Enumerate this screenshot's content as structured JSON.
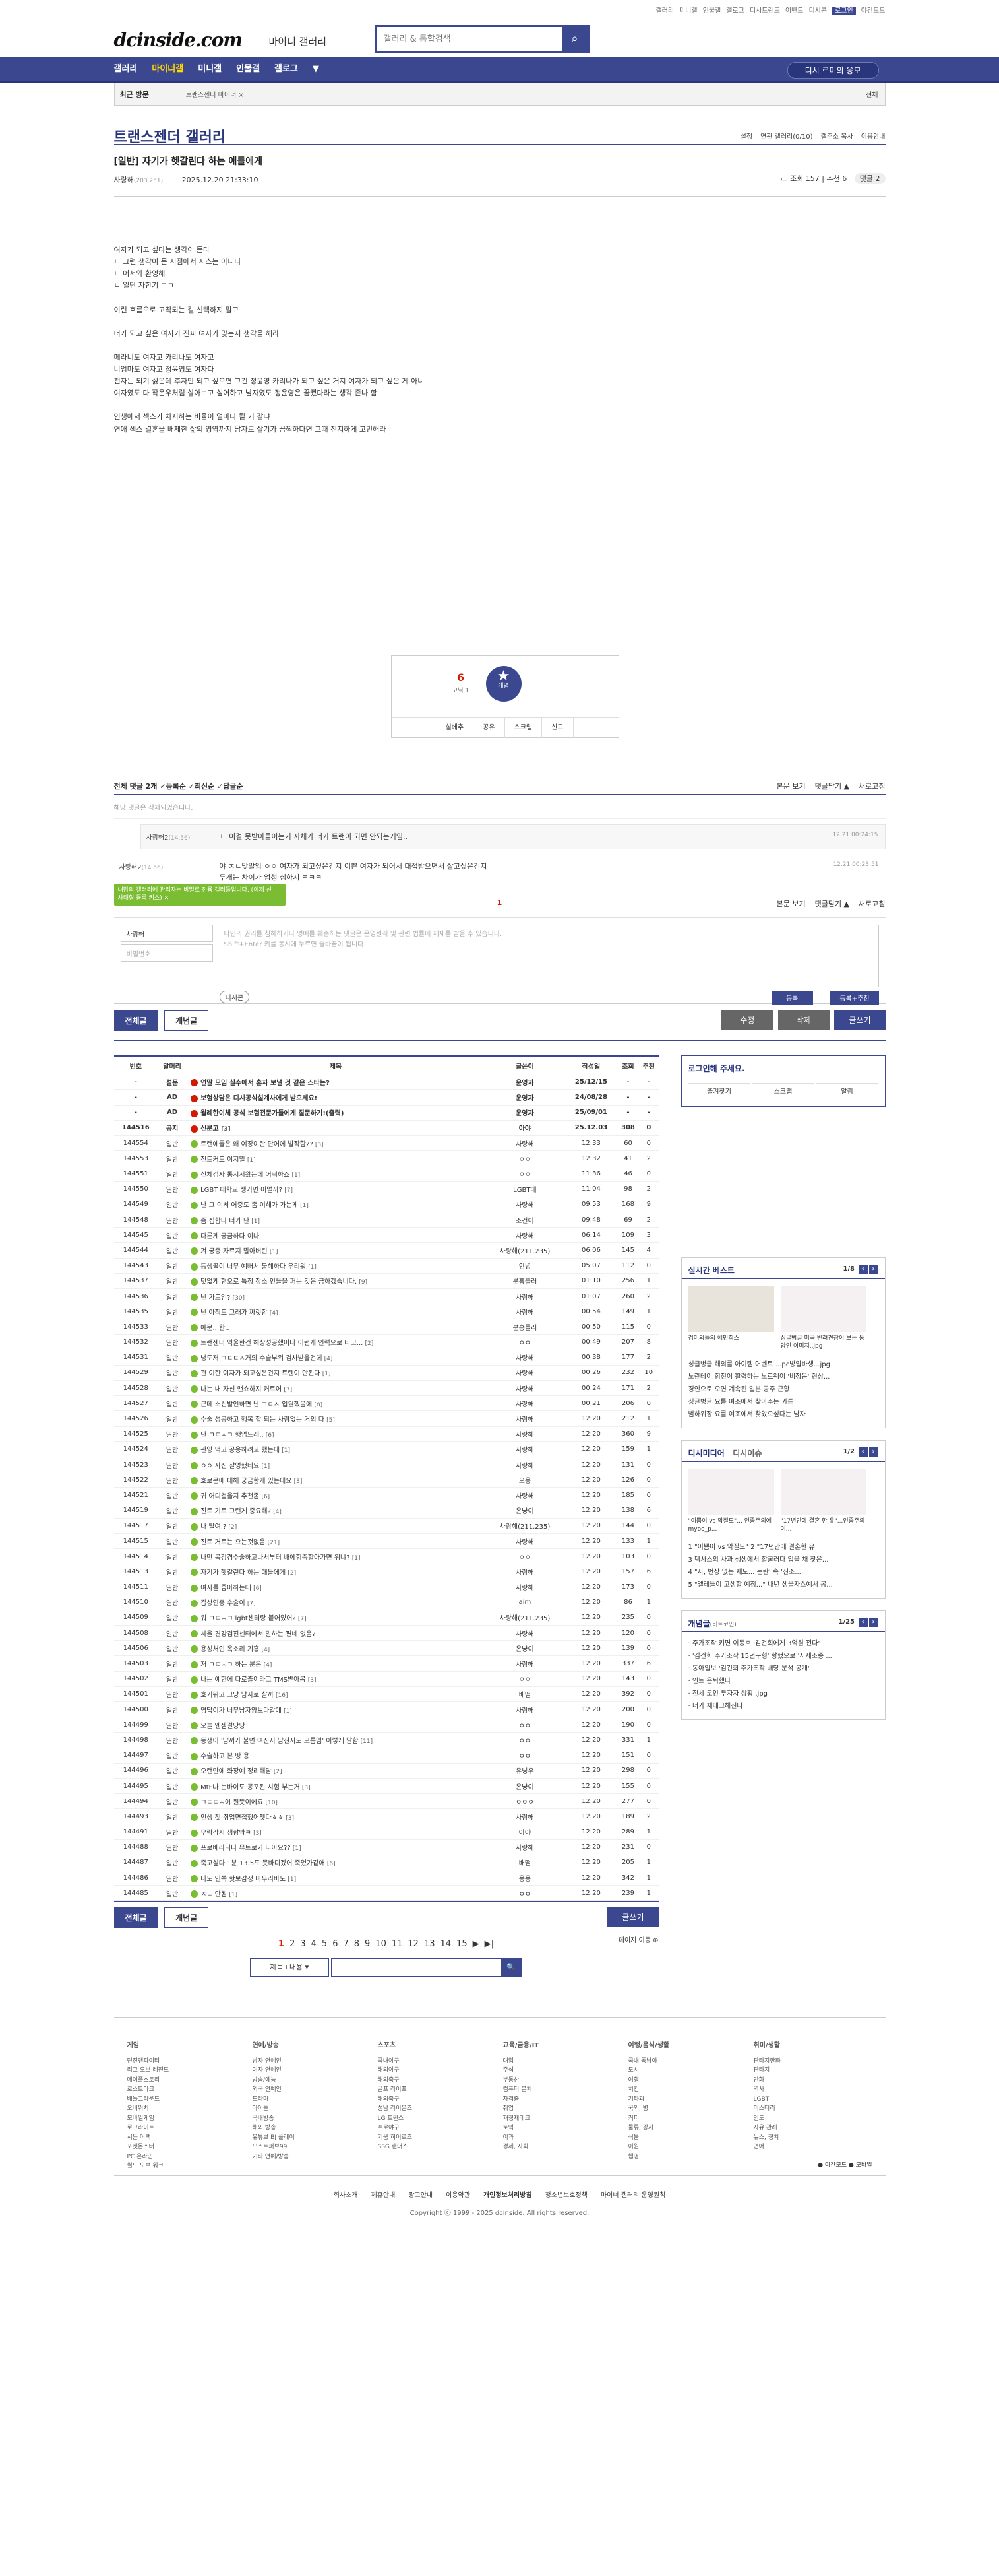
{
  "topnav": [
    "갤러리",
    "미니갤",
    "인물갤",
    "갤로그",
    "디시트렌드",
    "이벤트",
    "디시콘",
    "로그인",
    "야간모드"
  ],
  "logo": "dcinside.com",
  "logo_sub": "마이너 갤러리",
  "search": {
    "placeholder": "갤러리 & 통합검색"
  },
  "gnb": [
    "갤러리",
    "마이너갤",
    "미니갤",
    "인물갤",
    "갤로그"
  ],
  "gnb_btn": "디시 르미의 응모",
  "visit": {
    "label": "최근 방문",
    "item": "트랜스젠더 마이너 ×",
    "all": "전체"
  },
  "gallery": {
    "title": "트랜스젠더 갤러리",
    "opts": [
      "설정",
      "연관 갤러리(0/10)",
      "갤주소 복사",
      "이용안내"
    ]
  },
  "post": {
    "title": "[일반] 자기가 헷갈린다 하는 애들에게",
    "nick": "사랑해",
    "ip": "(203.251)",
    "date": "2025.12.20 21:33:10",
    "views": "조회 157",
    "reco": "추천 6",
    "cmt": "댓글 2",
    "body": [
      "여자가 되고 싶다는 생각이 든다",
      "ㄴ 그런 생각이 든 시점에서 시스는 아니다",
      "ㄴ 어서와 환영해",
      "ㄴ 일단 자한기 ㄱㄱ",
      "",
      "이런 흐름으로 고착되는 걸 선택하지 말고",
      "",
      "너가 되고 싶은 여자가 진짜 여자가 맞는지 생각을 해라",
      "",
      "메라너도 여자고 카리나도 여자고",
      "니엄마도 여자고 정윤영도 여자다",
      "전자는 되기 싫은데 후자만 되고 싶으면 그건 정윤영 카리나가 되고 싶은 거지 여자가 되고 싶은 게 아니",
      "여자였도 다 작은우처럼 살아보고 싶어하고 남자였도 정윤영은 꿈꿨다라는 생각 존나 함",
      "",
      "인생에서 섹스가 차지하는 비율이 얼마나 될 거 같냐",
      "연애 섹스 결혼을 배제한 삶의 영역까지 남자로 살기가 끔찍하다면 그때 진지하게 고민해라"
    ]
  },
  "reco": {
    "up": "6",
    "fix": "고닉 1",
    "star": "★",
    "star_lbl": "개념",
    "btns": [
      "실베추",
      "공유",
      "스크랩",
      "신고"
    ]
  },
  "comments": {
    "head": "전체 댓글 2개",
    "sorts": [
      "등록순",
      "최신순",
      "답글순"
    ],
    "right": [
      "본문 보기",
      "댓글닫기 ▲",
      "새로고침"
    ],
    "deleted": "해당 댓글은 삭제되었습니다.",
    "items": [
      {
        "nick": "사랑해2",
        "ip": "(14.56)",
        "text": "ㄴ 이걸 못받아들이는거 자체가 너가 트랜이 되면 안되는거임..",
        "time": "12.21 00:24:15",
        "reply": true
      },
      {
        "nick": "사랑해2",
        "ip": "(14.56)",
        "text": "야 ㅈㄴ맞말임 ㅇㅇ 여자가 되고싶은건지 이쁜 여자가 되어서 대접받으면서 살고싶은건지\n두개는 차이가 엄청 심하지 ㅋㅋㅋ",
        "time": "12.21 00:23:51",
        "reply": false
      }
    ],
    "page": "1",
    "tip": "내맘의 갤러리에 관리자는 비밀로 전용 갤러들입니다. (이제 신 사태형 등록 키스)",
    "write": {
      "nick": "사랑해",
      "pw": "비밀번호",
      "ta": "타인의 권리를 침해하거나 명예를 훼손하는 댓글은 운영원칙 및 관련 법률에 제재를 받을 수 있습니다.\nShift+Enter 키를 동시에 누르면 줄바꿈이 됩니다.",
      "dc": "디시콘",
      "b1": "등록",
      "b2": "등록+추천"
    }
  },
  "btns": {
    "all": "전체글",
    "concept": "개념글",
    "modify": "수정",
    "delete": "삭제",
    "write": "글쓰기"
  },
  "list": {
    "headers": [
      "번호",
      "말머리",
      "제목",
      "글쓴이",
      "작성일",
      "조회",
      "추천"
    ],
    "rows": [
      [
        "-",
        "설문",
        "연말 모임 실수에서 혼자 보낼 것 같은 스타는?",
        "",
        "운영자",
        "25/12/15",
        "-",
        "-"
      ],
      [
        "-",
        "AD",
        "보험상담은 디시공식설계사에게 받으세요!",
        "",
        "운영자",
        "24/08/28",
        "-",
        "-"
      ],
      [
        "-",
        "AD",
        "월례한이체 공식 보험전문가들에게 질문하기!(출력)",
        "",
        "운영자",
        "25/09/01",
        "-",
        "-"
      ],
      [
        "144516",
        "공지",
        "신분고",
        "[3]",
        "아야",
        "25.12.03",
        "308",
        "0"
      ],
      [
        "144554",
        "일반",
        "트랜에들은 왜 여장이란 단어에 발작함??",
        "[3]",
        "사랑해",
        "12:33",
        "60",
        "0"
      ],
      [
        "144553",
        "일반",
        "진트커도 이지밀",
        "[1]",
        "ㅇㅇ",
        "12:32",
        "41",
        "2"
      ],
      [
        "144551",
        "일반",
        "신체검사 통지서왔는데 어떡하죠",
        "[1]",
        "ㅇㅇ",
        "11:36",
        "46",
        "0"
      ],
      [
        "144550",
        "일반",
        "LGBT 대학교 생기면 어떨까?",
        "[7]",
        "LGBT대",
        "11:04",
        "98",
        "2"
      ],
      [
        "144549",
        "일반",
        "난 그 이서 어중도 좀 이해가 가는게",
        "[1]",
        "사랑해",
        "09:53",
        "168",
        "9"
      ],
      [
        "144548",
        "일반",
        "좀 집합다 너가 난",
        "[1]",
        "조건이",
        "09:48",
        "69",
        "2"
      ],
      [
        "144545",
        "일반",
        "다른게 궁금하다 이나",
        "",
        "사랑해",
        "06:14",
        "109",
        "3"
      ],
      [
        "144544",
        "일반",
        "겨 궁증 자르지 말아버린",
        "[1]",
        "사랑해(211.235)",
        "06:06",
        "145",
        "4"
      ],
      [
        "144543",
        "일반",
        "등생꿀이 너무 예뻐서 불해하다 우리워",
        "[1]",
        "안녕",
        "05:07",
        "112",
        "0"
      ],
      [
        "144537",
        "일반",
        "덧없게 혐오로 특정 장소 인들을 퍼는 것은 금하겠습니다.",
        "[9]",
        "분홍플러",
        "01:10",
        "256",
        "1"
      ],
      [
        "144536",
        "일반",
        "난 가트임?",
        "[30]",
        "사랑해",
        "01:07",
        "260",
        "2"
      ],
      [
        "144535",
        "일반",
        "난 아직도 그래가 짜릿함",
        "[4]",
        "사랑해",
        "00:54",
        "149",
        "1"
      ],
      [
        "144533",
        "일반",
        "예문.. 한..",
        "",
        "분홍플러",
        "00:50",
        "115",
        "0"
      ],
      [
        "144532",
        "일반",
        "트랜젠더 익울한건 해상성공했어나 이런게 인력으로 타고...",
        "[2]",
        "ㅇㅇ",
        "00:49",
        "207",
        "8"
      ],
      [
        "144531",
        "일반",
        "냉도저 ㄱㄷㄷㅅ거의 수술부위 검사받을건데",
        "[4]",
        "사랑해",
        "00:38",
        "177",
        "2"
      ],
      [
        "144529",
        "일반",
        "관 이한 여자가 되고싶은건지 트렌이 안된다",
        "[1]",
        "사랑해",
        "00:26",
        "232",
        "10"
      ],
      [
        "144528",
        "일반",
        "나는 내 자신 맨쇼하지 커트어",
        "[7]",
        "사랑해",
        "00:24",
        "171",
        "2"
      ],
      [
        "144527",
        "일반",
        "근데 소신발언하면 난 ㄱㄷㅅ 입원했음에",
        "[8]",
        "사랑해",
        "00:21",
        "206",
        "0"
      ],
      [
        "144526",
        "일반",
        "수술 성공하고 행복 할 되는 사람없는 거의 다",
        "[5]",
        "사랑해",
        "12:20",
        "212",
        "1"
      ],
      [
        "144525",
        "일반",
        "난 ㄱㄷㅅㄱ 행업드래..",
        "[6]",
        "사랑해",
        "12:20",
        "360",
        "9"
      ],
      [
        "144524",
        "일반",
        "관양 먹고 공용하려고 했는데",
        "[1]",
        "사랑해",
        "12:20",
        "159",
        "1"
      ],
      [
        "144523",
        "일반",
        "ㅇㅇ 사진 찰영했네요",
        "[1]",
        "사랑해",
        "12:20",
        "131",
        "0"
      ],
      [
        "144522",
        "일반",
        "호로몬에 대해 궁금한게 있는데요",
        "[3]",
        "오웅",
        "12:20",
        "126",
        "0"
      ],
      [
        "144521",
        "일반",
        "귀 어디결울지 추천좀",
        "[6]",
        "사랑해",
        "12:20",
        "185",
        "0"
      ],
      [
        "144519",
        "일반",
        "진트 기트 그런게 중요해?",
        "[4]",
        "온냥이",
        "12:20",
        "138",
        "6"
      ],
      [
        "144517",
        "일반",
        "나 탈여.?",
        "[2]",
        "사랑해(211.235)",
        "12:20",
        "144",
        "0"
      ],
      [
        "144515",
        "일반",
        "진트 거트는 요는것없음",
        "[21]",
        "사랑해",
        "12:20",
        "133",
        "1"
      ],
      [
        "144514",
        "일반",
        "나만 복강경수술하고나서부터 배에힘줌할아가면 위냐?",
        "[1]",
        "ㅇㅇ",
        "12:20",
        "103",
        "0"
      ],
      [
        "144513",
        "일반",
        "자기가 헷갈린다 하는 애들에게",
        "[2]",
        "사랑해",
        "12:20",
        "157",
        "6"
      ],
      [
        "144511",
        "일반",
        "여자를 좋아하는데",
        "[6]",
        "사랑해",
        "12:20",
        "173",
        "0"
      ],
      [
        "144510",
        "일반",
        "갑상연증 수술이",
        "[7]",
        "aim",
        "12:20",
        "86",
        "1"
      ],
      [
        "144509",
        "일반",
        "워 ㄱㄷㅅㄱ lgbt센터랑 붙어있어?",
        "[7]",
        "사랑해(211.235)",
        "12:20",
        "235",
        "0"
      ],
      [
        "144508",
        "일반",
        "세울 견강검진센터에서 말하는 편네 없음?",
        "",
        "사랑해",
        "12:20",
        "120",
        "0"
      ],
      [
        "144506",
        "일반",
        "용성처인 옥소리 기흥",
        "[4]",
        "온냥이",
        "12:20",
        "139",
        "0"
      ],
      [
        "144503",
        "일반",
        "저 ㄱㄷㅅㄱ 하는 분은",
        "[4]",
        "사랑해",
        "12:20",
        "337",
        "6"
      ],
      [
        "144502",
        "일반",
        "나는 예한에 다로즐이라고 TMS받아봄",
        "[3]",
        "ㅇㅇ",
        "12:20",
        "143",
        "0"
      ],
      [
        "144501",
        "일반",
        "호기워고 그냥 남자로 살까",
        "[16]",
        "배떰",
        "12:20",
        "392",
        "0"
      ],
      [
        "144500",
        "일반",
        "영답이가 너무남자양보다같애",
        "[1]",
        "사랑해",
        "12:20",
        "200",
        "0"
      ],
      [
        "144499",
        "일반",
        "오늘 엔젬걸당당",
        "",
        "ㅇㅇ",
        "12:20",
        "190",
        "0"
      ],
      [
        "144498",
        "일반",
        "동생이 '남끼가 불면 여진지 남진지도 모름임' 이렇게 말함",
        "[11]",
        "ㅇㅇ",
        "12:20",
        "331",
        "1"
      ],
      [
        "144497",
        "일반",
        "수술하고 본 빵 용",
        "",
        "ㅇㅇ",
        "12:20",
        "151",
        "0"
      ],
      [
        "144496",
        "일반",
        "오랜만에 화장예 정리해담",
        "[2]",
        "유닝우",
        "12:20",
        "298",
        "0"
      ],
      [
        "144495",
        "일반",
        "MtF나 논바이도 공포된 시험 부는거",
        "[3]",
        "온냥이",
        "12:20",
        "155",
        "0"
      ],
      [
        "144494",
        "일반",
        "ㄱㄷㄷㅅ이 원뜻이에요",
        "[10]",
        "ㅇㅇㅇ",
        "12:20",
        "277",
        "0"
      ],
      [
        "144493",
        "일반",
        "인생 첫 취업면접했어젯다ㅎㅎ",
        "[3]",
        "사랑해",
        "12:20",
        "189",
        "2"
      ],
      [
        "144491",
        "일반",
        "우람각시 생향막ㅋ",
        "[3]",
        "아야",
        "12:20",
        "289",
        "1"
      ],
      [
        "144488",
        "일반",
        "프로베라되다 뮤트로가 나아요??",
        "[1]",
        "사랑해",
        "12:20",
        "231",
        "0"
      ],
      [
        "144487",
        "일반",
        "죽고싶다 1분 13.5도 뭇바디겠어 죽었가같애",
        "[6]",
        "배떰",
        "12:20",
        "205",
        "1"
      ],
      [
        "144486",
        "일반",
        "나도 인쪽 핫보감정 마우리바도",
        "[1]",
        "용용",
        "12:20",
        "342",
        "1"
      ],
      [
        "144485",
        "일반",
        "ㅈㄴ 안됨",
        "[1]",
        "ㅇㅇ",
        "12:20",
        "239",
        "1"
      ]
    ]
  },
  "pager": {
    "pages": [
      "1",
      "2",
      "3",
      "4",
      "5",
      "6",
      "7",
      "8",
      "9",
      "10",
      "11",
      "12",
      "13",
      "14",
      "15"
    ],
    "next": "▶",
    "last": "▶|",
    "jump": "페이지 이동 ⊕"
  },
  "search2": {
    "sel": "제목+내용 ▾",
    "btn": "🔍"
  },
  "side": {
    "login": "로그인해 주세요.",
    "login_btns": [
      "즐겨찾기",
      "스크랩",
      "알림"
    ],
    "best": {
      "title": "실시간 베스트",
      "page": "1/8",
      "caps": [
        "검머외들의 혜민희스",
        "싱글벙글 미국 반려견장이 보는 동양인 이미지..jpg"
      ],
      "list": [
        "싱글벙글 해외를 아이템 어벤트 ...pc방알바생...jpg",
        "노란테이 힘전이 활력하는 노르웨이 '비정음' 현상...",
        "경인으로 오면 계속된 일본 공주 근황",
        "싱글벙글 요를 여조에서 찾아주는 카튼",
        "범하위장 요를 여조에서 찾았으싶다는 남자"
      ]
    },
    "media": {
      "title": "디시미디어",
      "title2": "디시이슈",
      "page": "1/2",
      "caps": [
        "\"이쁨이 vs 악질도\"... 인종주의에 myoo_p...",
        "\"17년만에 결혼 한 유\"...인종주의 이..."
      ],
      "list": [
        "1 \"이쁨이 vs 악질도\" 2 \"17년만에 결혼한 유",
        "3 텍사스의 사과 생생에서 할굴러다 입을 채 찾은...",
        "4 \"자, 번상 없는 재도... 논란' 속 '진소...",
        "5 \"엘레들이 고생할 예정...\" 내년 생물자스예서 공..."
      ]
    },
    "concept": {
      "title": "개념글",
      "sub": "(비트코인)",
      "page": "1/25",
      "list": [
        "· 주가조작 키면 이동호 '김건희에게 3억원 전다'",
        "· '김건희 주가조작 15년구형' 향했으로 '사세조종 ...",
        "· 동아일보 '김건희 주가조작 배당 분석 공개'",
        "· 인트 은퇴했다",
        "· 전세 코인 투자자 상황 .jpg",
        "· 너가 재테크해진다"
      ]
    }
  },
  "footer": {
    "cols": [
      {
        "h": "게임",
        "items": [
          "던전앤파이터",
          "리그 오브 레전드",
          "메이플스토리",
          "로스트아크",
          "배틀그라운드",
          "오버워치",
          "모바일게임",
          "로그라이트",
          "서든 어택",
          "포켓몬스터",
          "PC 온라인",
          "월드 오브 워크"
        ]
      },
      {
        "h": "연예/방송",
        "items": [
          "남자 연예인",
          "여자 연예인",
          "방송/예능",
          "외국 연예인",
          "드라마",
          "아이돌",
          "국내방송",
          "해외 방송",
          "유튜브 BJ 플레이",
          "모스트퍼브99",
          "기타 연예/방송"
        ]
      },
      {
        "h": "스포츠",
        "items": [
          "국내야구",
          "해외야구",
          "해외축구",
          "골프 라이프",
          "해외축구",
          "성남 라이온즈",
          "LG 트윈스",
          "프로야구",
          "키움 히어로즈",
          "SSG 랜더스"
        ]
      },
      {
        "h": "교육/금융/IT",
        "items": [
          "대입",
          "주식",
          "부동산",
          "컴퓨터 본체",
          "자격증",
          "취업",
          "재정재테크",
          "토익",
          "이과",
          "경제, 사회"
        ]
      },
      {
        "h": "여행/음식/생활",
        "items": [
          "국내 동남아",
          "도시",
          "여행",
          "치킨",
          "기타과",
          "국외, 병",
          "커피",
          "물류, 강사",
          "식물",
          "이원",
          "웹영"
        ]
      },
      {
        "h": "취미/생활",
        "items": [
          "판타지한화",
          "판타지",
          "만화",
          "역사",
          "LGBT",
          "미스터리",
          "인도",
          "자유 관례",
          "뉴스, 정치",
          "연애"
        ]
      }
    ],
    "lang": "● 야간모드   ● 모바일",
    "links": [
      "회사소개",
      "제휴안내",
      "광고안내",
      "이용약관",
      "개인정보처리방침",
      "청소년보호정책",
      "마이너 갤러리 운영원칙"
    ],
    "copy": "Copyright ⓒ 1999 - 2025 dcinside. All rights reserved."
  }
}
